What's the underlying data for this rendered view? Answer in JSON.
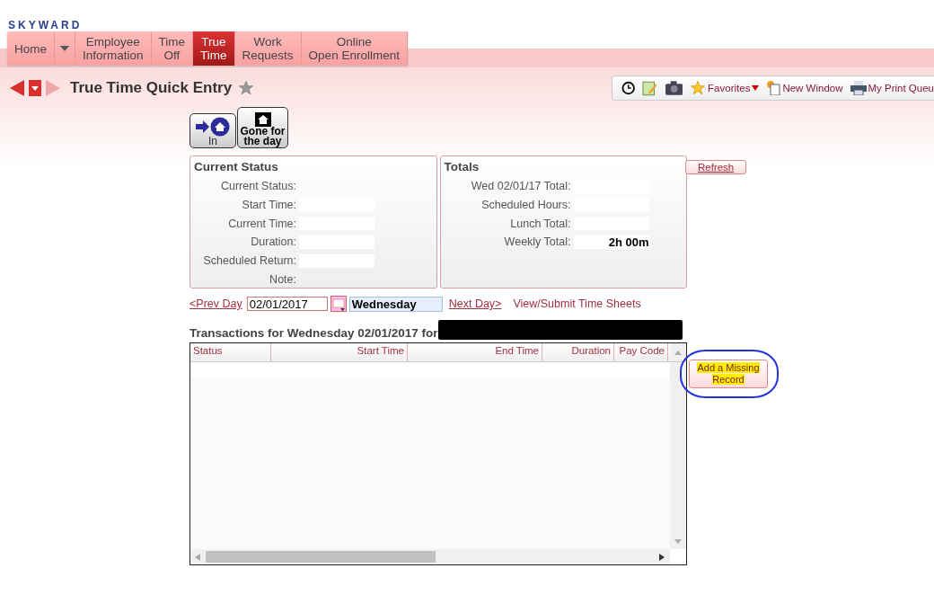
{
  "logo": {
    "text": "SKYWARD"
  },
  "nav": [
    {
      "lines": [
        "Home"
      ],
      "selected": false,
      "has_menu": true
    },
    {
      "lines": [
        "Employee",
        "Information"
      ],
      "selected": false,
      "has_menu": false
    },
    {
      "lines": [
        "Time",
        "Off"
      ],
      "selected": false,
      "has_menu": false
    },
    {
      "lines": [
        "True",
        "Time"
      ],
      "selected": true,
      "has_menu": false
    },
    {
      "lines": [
        "Work",
        "Requests"
      ],
      "selected": false,
      "has_menu": false
    },
    {
      "lines": [
        "Online",
        "Open Enrollment"
      ],
      "selected": false,
      "has_menu": false
    }
  ],
  "page": {
    "title": "True Time Quick Entry",
    "favorite": false
  },
  "toolbar": [
    {
      "kind": "clock"
    },
    {
      "kind": "notes"
    },
    {
      "kind": "camera"
    },
    {
      "kind": "favorites",
      "label": "Favorites"
    },
    {
      "kind": "window",
      "label": "New Window"
    },
    {
      "kind": "print",
      "label": "My Print Queu"
    }
  ],
  "clock_buttons": [
    {
      "kind": "in",
      "label": "In"
    },
    {
      "kind": "gone",
      "label": "Gone for the day"
    }
  ],
  "current_status": {
    "title": "Current Status",
    "fields": [
      {
        "label": "Current Status:",
        "kind": "text"
      },
      {
        "label": "Start Time:",
        "kind": "box"
      },
      {
        "label": "Current Time:",
        "kind": "box"
      },
      {
        "label": "Duration:",
        "kind": "box"
      },
      {
        "label": "Scheduled Return:",
        "kind": "box"
      },
      {
        "label": "Note:",
        "kind": "text"
      }
    ]
  },
  "totals": {
    "title": "Totals",
    "fields": [
      {
        "label": "Wed 02/01/17 Total:"
      },
      {
        "label": "Scheduled Hours:"
      },
      {
        "label": "Lunch Total:"
      },
      {
        "label": "Weekly Total:",
        "value": "2h 00m"
      }
    ]
  },
  "refresh_button": {
    "label": "Refresh"
  },
  "day_nav": {
    "prev": "<Prev Day",
    "date": "02/01/2017",
    "day": "Wednesday",
    "next": "Next Day>",
    "link": "View/Submit Time Sheets"
  },
  "transactions": {
    "title": "Transactions for Wednesday 02/01/2017 for",
    "redacted": true,
    "columns": [
      "Status",
      "Start Time",
      "End Time",
      "Duration",
      "Pay Code"
    ]
  },
  "add_button": {
    "label": "Add a Missing Record",
    "highlighted": true,
    "circled": true
  }
}
